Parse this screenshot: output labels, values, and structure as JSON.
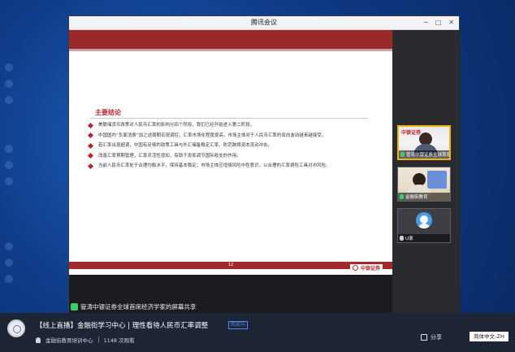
{
  "app": {
    "window_title": "腾讯会议"
  },
  "slide": {
    "section_title": "主要结论",
    "page_number": "12",
    "footer_brand": "中银证券",
    "bullets": [
      "美联储货币政策对人民币汇率的影响分四个阶段，我们已经开始进入第二阶段。",
      "中国国内“负面消费”加之逆周期宏观调控，汇率市场化程度提高，市场主体对于人民币汇率的双向波动越来越接受。",
      "若汇率出现超调，中国有足够的政策工具与外汇储备稳定汇率，防范跨境资本流动冲击。",
      "改善汇率预期管理，汇率灵活性增加，有助于发挥调节国际收支的作用。",
      "当前人民币汇率处于合理均衡水平，保持基本稳定；市场主体应增强风险中性意识，以合理的汇率避险工具对冲风险。"
    ]
  },
  "participants": [
    {
      "name": "管涛中银证券全球首席...",
      "brand": "中银证券"
    },
    {
      "name": "金融街教育"
    },
    {
      "name": "U滚"
    }
  ],
  "share_bar": {
    "label": "管涛中银证券全球首席经济学家的屏幕共享"
  },
  "info": {
    "title": "【线上直播】金融街学习中心 | 理性看待人民币汇率调整",
    "status_badge": "回放中",
    "org": "金融街教育培训中心",
    "views": "1148 次观看",
    "share": "分享",
    "language": "简体中文-ZH"
  },
  "colors": {
    "slide_accent": "#b5272b",
    "live_blue": "#4c8df5",
    "active_speaker": "#f2b21a",
    "mic_green": "#37d06e"
  }
}
